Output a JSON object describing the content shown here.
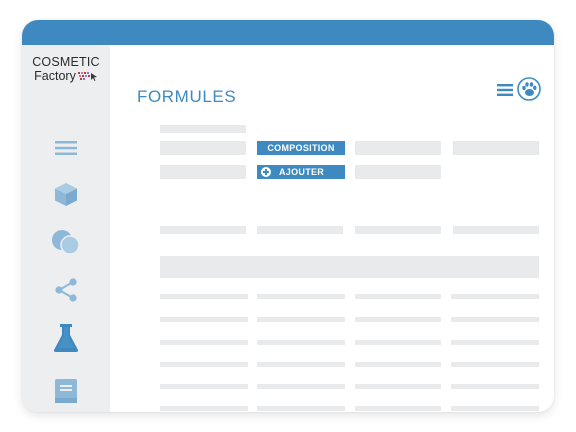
{
  "logo": {
    "line1": "COSMETIC",
    "line2": "Factory"
  },
  "sidebar": {
    "items": [
      {
        "name": "menu",
        "icon": "menu-icon"
      },
      {
        "name": "products",
        "icon": "box-icon"
      },
      {
        "name": "ingredients",
        "icon": "circles-icon"
      },
      {
        "name": "share",
        "icon": "share-icon"
      },
      {
        "name": "formulas",
        "icon": "flask-icon",
        "active": true
      },
      {
        "name": "documentation",
        "icon": "book-icon"
      }
    ]
  },
  "header": {
    "title": "FORMULES",
    "menu_icon": "hamburger-icon",
    "profile_icon": "paw-icon"
  },
  "actions": {
    "composition_label": "COMPOSITION",
    "add_label": "AJOUTER",
    "add_icon": "plus-circle-icon"
  },
  "colors": {
    "accent": "#3e8ac0",
    "placeholder": "#e8eaeb",
    "sidebar_bg": "#eceeef",
    "active_icon": "#3e8ac0",
    "inactive_icon": "#8eb8d8"
  }
}
